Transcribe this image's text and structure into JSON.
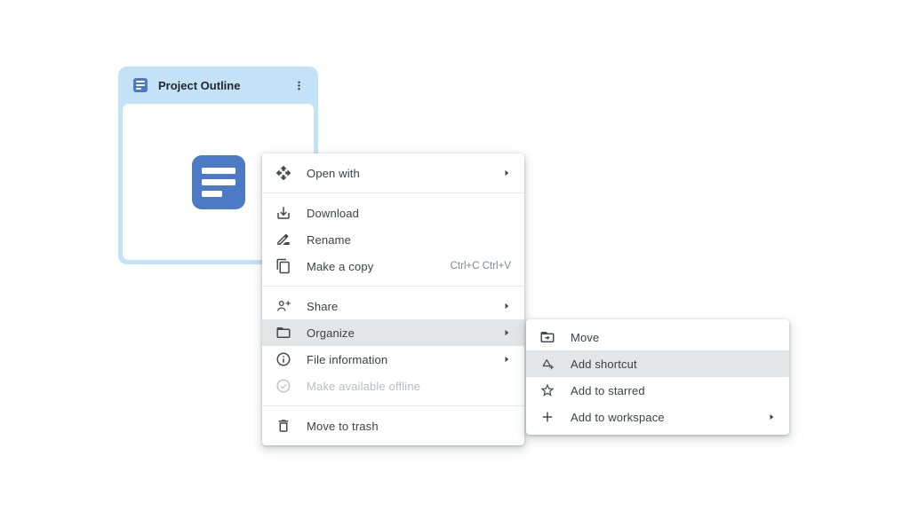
{
  "page": {
    "background": "#ffffff"
  },
  "colors": {
    "card_selection_blue": "#c3e2f7",
    "docs_icon_blue": "#4d7ac4",
    "menu_hover_gray": "#e4e5e6",
    "menu_text": "#3c4043",
    "disabled_text": "#b9bcc0",
    "shortcut_hint_text": "#80868b",
    "divider": "#e7e7e8"
  },
  "card": {
    "title": "Project Outline",
    "icons": [
      "docs-file-icon",
      "more-vert-icon",
      "docs-file-large-icon"
    ]
  },
  "menu": {
    "items": {
      "open_with": {
        "label": "Open with",
        "icon": "open-with-icon",
        "has_submenu": true
      },
      "download": {
        "label": "Download",
        "icon": "download-icon"
      },
      "rename": {
        "label": "Rename",
        "icon": "rename-icon"
      },
      "make_a_copy": {
        "label": "Make a copy",
        "icon": "copy-icon",
        "shortcut": "Ctrl+C Ctrl+V"
      },
      "share": {
        "label": "Share",
        "icon": "share-icon",
        "has_submenu": true
      },
      "organize": {
        "label": "Organize",
        "icon": "folder-icon",
        "has_submenu": true,
        "state": "highlighted"
      },
      "file_information": {
        "label": "File information",
        "icon": "info-icon",
        "has_submenu": true
      },
      "make_available_offline": {
        "label": "Make available offline",
        "icon": "offline-check-icon",
        "state": "disabled"
      },
      "move_to_trash": {
        "label": "Move to trash",
        "icon": "trash-icon"
      }
    }
  },
  "submenu": {
    "items": {
      "move": {
        "label": "Move",
        "icon": "move-folder-icon"
      },
      "add_shortcut": {
        "label": "Add shortcut",
        "icon": "add-shortcut-icon",
        "state": "highlighted"
      },
      "add_to_starred": {
        "label": "Add to starred",
        "icon": "star-icon"
      },
      "add_to_workspace": {
        "label": "Add to workspace",
        "icon": "plus-icon",
        "has_submenu": true
      }
    }
  }
}
